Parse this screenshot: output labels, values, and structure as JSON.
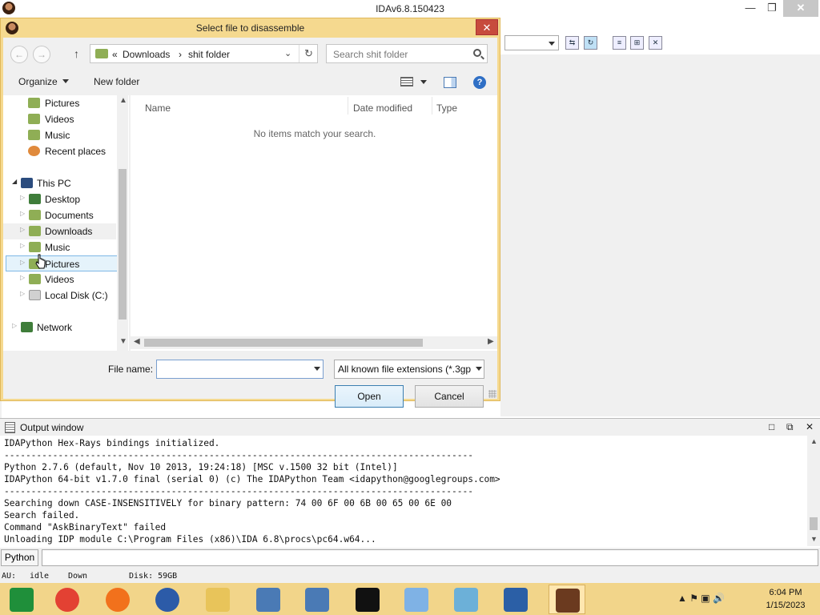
{
  "ida": {
    "title": "IDAv6.8.150423",
    "window_controls": {
      "minimize": "—",
      "restore": "❐",
      "close": "✕"
    }
  },
  "dialog": {
    "title": "Select file to disassemble",
    "close": "✕",
    "nav": {
      "back": "←",
      "forward": "→",
      "up": "↑"
    },
    "address": {
      "prefix": "«",
      "segments": [
        "Downloads",
        "shit folder"
      ],
      "separator": "›",
      "drop": "⌄",
      "refresh": "↻"
    },
    "search_placeholder": "Search shit folder",
    "organize": "Organize",
    "new_folder": "New folder",
    "help": "?",
    "tree": [
      {
        "label": "Pictures",
        "icon": "pictures-icon",
        "color": "#8fae55"
      },
      {
        "label": "Videos",
        "icon": "videos-icon",
        "color": "#8fae55"
      },
      {
        "label": "Music",
        "icon": "music-icon",
        "color": "#8fae55"
      },
      {
        "label": "Recent places",
        "icon": "recent-places-icon",
        "color": "#e08a3c"
      },
      {
        "label": "This PC",
        "icon": "computer-icon",
        "color": "#2b4c7e"
      },
      {
        "label": "Desktop",
        "icon": "desktop-icon",
        "color": "#3f7d3a"
      },
      {
        "label": "Documents",
        "icon": "documents-icon",
        "color": "#8fae55"
      },
      {
        "label": "Downloads",
        "icon": "downloads-icon",
        "color": "#8fae55"
      },
      {
        "label": "Music",
        "icon": "music-icon",
        "color": "#8fae55"
      },
      {
        "label": "Pictures",
        "icon": "pictures-icon",
        "color": "#8fae55"
      },
      {
        "label": "Videos",
        "icon": "videos-icon",
        "color": "#8fae55"
      },
      {
        "label": "Local Disk (C:)",
        "icon": "disk-icon",
        "color": "#c8c8c8"
      },
      {
        "label": "Network",
        "icon": "network-icon",
        "color": "#3f7d3a"
      }
    ],
    "columns": [
      "Name",
      "Date modified",
      "Type"
    ],
    "empty_message": "No items match your search.",
    "file_name_label": "File name:",
    "file_name_value": "",
    "file_type": "All known file extensions (*.3gp",
    "open_button": "Open",
    "cancel_button": "Cancel"
  },
  "output": {
    "title": "Output window",
    "controls": {
      "restore": "□",
      "float": "⧉",
      "close": "✕"
    },
    "lines": [
      "IDAPython Hex-Rays bindings initialized.",
      "---------------------------------------------------------------------------------------",
      "Python 2.7.6 (default, Nov 10 2013, 19:24:18) [MSC v.1500 32 bit (Intel)]",
      "IDAPython 64-bit v1.7.0 final (serial 0) (c) The IDAPython Team <idapython@googlegroups.com>",
      "---------------------------------------------------------------------------------------",
      "Searching down CASE-INSENSITIVELY for binary pattern: 74 00 6F 00 6B 00 65 00 6E 00",
      "Search failed.",
      "Command \"AskBinaryText\" failed",
      "Unloading IDP module C:\\Program Files (x86)\\IDA 6.8\\procs\\pc64.w64..."
    ]
  },
  "cmdline": {
    "language": "Python"
  },
  "status": {
    "au_label": "AU:",
    "au_value": "idle",
    "direction": "Down",
    "disk": "Disk: 59GB"
  },
  "taskbar": {
    "apps": [
      {
        "name": "media-player-icon",
        "color": "#1f8f3a"
      },
      {
        "name": "chrome-icon",
        "color": "#e34133"
      },
      {
        "name": "firefox-icon",
        "color": "#f2711c"
      },
      {
        "name": "obama-logo-icon",
        "color": "#2c5ba8"
      },
      {
        "name": "file-explorer-icon",
        "color": "#e8c45a"
      },
      {
        "name": "network-tool-icon",
        "color": "#4a7ab5"
      },
      {
        "name": "network-tool-2-icon",
        "color": "#4a7ab5"
      },
      {
        "name": "7zip-icon",
        "color": "#111111"
      },
      {
        "name": "paint-icon",
        "color": "#7fb2e5"
      },
      {
        "name": "notepad-icon",
        "color": "#6cb0d8"
      },
      {
        "name": "remote-desktop-icon",
        "color": "#2b5fa6"
      },
      {
        "name": "ida-icon",
        "color": "#6b3a1f"
      }
    ],
    "tray": "▲ ⚑ ▣ 🔊",
    "time": "6:04 PM",
    "date": "1/15/2023"
  }
}
